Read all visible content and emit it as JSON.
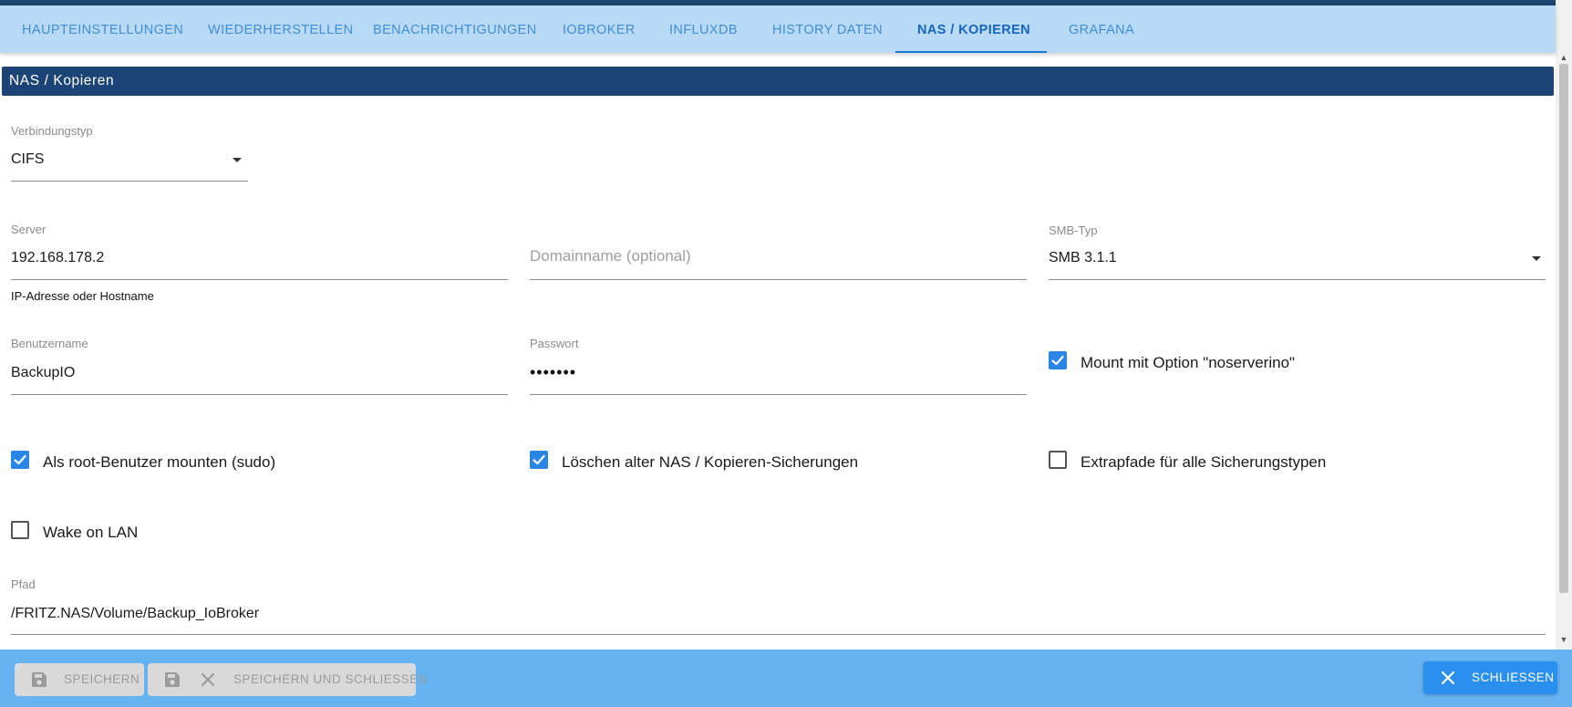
{
  "tabs": [
    {
      "label": "HAUPTEINSTELLUNGEN"
    },
    {
      "label": "WIEDERHERSTELLEN"
    },
    {
      "label": "BENACHRICHTIGUNGEN"
    },
    {
      "label": "IOBROKER"
    },
    {
      "label": "INFLUXDB"
    },
    {
      "label": "HISTORY DATEN"
    },
    {
      "label": "NAS / KOPIEREN",
      "active": true
    },
    {
      "label": "GRAFANA"
    }
  ],
  "section": {
    "title": "NAS / Kopieren"
  },
  "connection": {
    "label": "Verbindungstyp",
    "value": "CIFS"
  },
  "server": {
    "label": "Server",
    "value": "192.168.178.2",
    "helper": "IP-Adresse oder Hostname"
  },
  "domain": {
    "placeholder": "Domainname (optional)",
    "value": ""
  },
  "smb": {
    "label": "SMB-Typ",
    "value": "SMB 3.1.1"
  },
  "username": {
    "label": "Benutzername",
    "value": "BackupIO"
  },
  "password": {
    "label": "Passwort",
    "masked": "•••••••"
  },
  "checkboxes": {
    "noserverino": {
      "label": "Mount mit Option \"noserverino\"",
      "checked": true
    },
    "sudo": {
      "label": "Als root-Benutzer mounten (sudo)",
      "checked": true
    },
    "delete_old": {
      "label": "Löschen alter NAS / Kopieren-Sicherungen",
      "checked": true
    },
    "extra_paths": {
      "label": "Extrapfade für alle Sicherungstypen",
      "checked": false
    },
    "wol": {
      "label": "Wake on LAN",
      "checked": false
    }
  },
  "path": {
    "label": "Pfad",
    "value": "/FRITZ.NAS/Volume/Backup_IoBroker"
  },
  "footer": {
    "save_label": "SPEICHERN",
    "save_close_label": "SPEICHERN UND SCHLIESSEN",
    "close_label": "SCHLIESSEN"
  },
  "icons": {
    "save": "save-icon",
    "close": "close-icon",
    "dropdown": "caret-down-icon",
    "check": "checkmark-icon"
  },
  "colors": {
    "tab_bar": "#b9daf6",
    "active_tab": "#1565c0",
    "section_header": "#1d4476",
    "checkbox_checked": "#2a86e5",
    "footer": "#66b3f1",
    "primary_button": "#2a90f0"
  }
}
